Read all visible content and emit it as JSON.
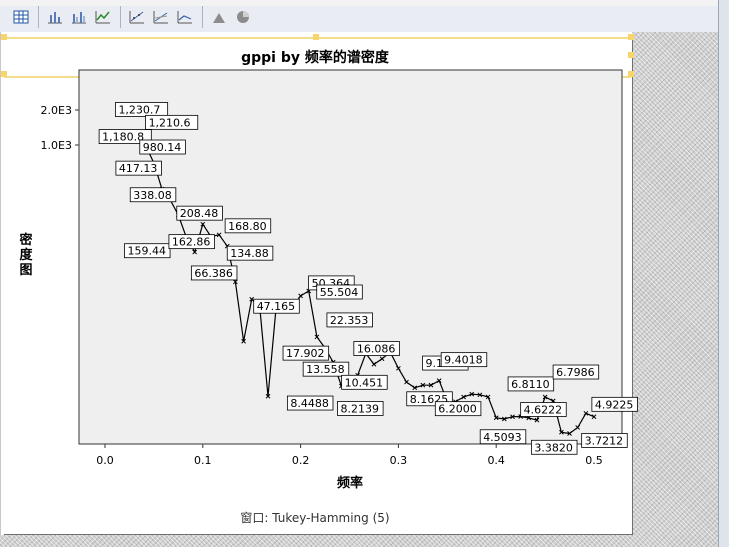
{
  "toolbar": {
    "icons": [
      "pivot-table-icon",
      "bar-chart-icon",
      "clustered-bar-icon",
      "line-chart-icon",
      "scatter-icon",
      "scatter-matrix-icon",
      "line-icon",
      "area-icon",
      "pie-icon"
    ]
  },
  "colors": {
    "plot_background": "#efefef",
    "line": "#000000",
    "selection_handle": "#f7d56b"
  },
  "footnote": "窗口: Tukey-Hamming (5)",
  "chart_data": {
    "type": "line",
    "title": "gppi by 频率的谱密度",
    "xlabel": "频率",
    "ylabel": "密度图",
    "y_scale": "log",
    "xlim": [
      -0.03,
      0.53
    ],
    "x_ticks": [
      0.0,
      0.1,
      0.2,
      0.3,
      0.4,
      0.5
    ],
    "x_tick_labels": [
      "0.0",
      "0.1",
      "0.2",
      "0.3",
      "0.4",
      "0.5"
    ],
    "y_ticks": [
      2000,
      1000
    ],
    "y_tick_labels": [
      "2.0E3",
      "1.0E3"
    ],
    "grid": false,
    "series": [
      {
        "x": [
          0.0083,
          0.0167,
          0.025,
          0.0333,
          0.0417,
          0.05,
          0.0583,
          0.0667,
          0.075,
          0.0833,
          0.0917,
          0.1,
          0.1083,
          0.1167,
          0.125,
          0.1333,
          0.1417,
          0.15,
          0.1583,
          0.1667,
          0.175,
          0.1833,
          0.1917,
          0.2,
          0.2083,
          0.2167,
          0.225,
          0.2333,
          0.2417,
          0.25,
          0.2583,
          0.2667,
          0.275,
          0.2833,
          0.2917,
          0.3,
          0.3083,
          0.3167,
          0.325,
          0.3333,
          0.3417,
          0.35,
          0.3583,
          0.3667,
          0.375,
          0.3833,
          0.3917,
          0.4,
          0.4083,
          0.4167,
          0.425,
          0.4333,
          0.4417,
          0.45,
          0.4583,
          0.4667,
          0.475,
          0.4833,
          0.4917,
          0.5
        ],
        "values": [
          1180.8,
          1190,
          1230.7,
          1210.6,
          980.14,
          700,
          417.13,
          338.08,
          250,
          159.44,
          120,
          208.48,
          162.86,
          168.8,
          134.88,
          66.386,
          20.5,
          47.165,
          40,
          6.9,
          40,
          42,
          40,
          50.364,
          55.504,
          22.353,
          17.902,
          13.558,
          8.4488,
          8.2139,
          10.451,
          16.086,
          13,
          14.5,
          16.5,
          12,
          9.1439,
          8.1625,
          8.6,
          8.6,
          9.4018,
          6.2,
          6.2,
          6.8,
          7.2,
          7.1,
          6.811,
          4.5093,
          4.4,
          4.6,
          4.6222,
          4.5,
          4.3,
          6.7986,
          6.3,
          3.382,
          3.3,
          3.7212,
          4.9225,
          4.6
        ]
      }
    ],
    "data_labels": [
      {
        "x": 0.0083,
        "value": "1,230.7",
        "label_y": 1230.7,
        "at": 0.025
      },
      {
        "x": 0.0083,
        "value": "1,180.8",
        "label_y": 1180.8,
        "at": 0.0083
      },
      {
        "x": 0.0333,
        "value": "1,210.6",
        "label_y": 1210.6,
        "at": 0.0333
      },
      {
        "x": 0.0417,
        "value": "980.14",
        "label_y": 980.14,
        "at": 0.0417
      },
      {
        "x": 0.05,
        "value": "417.13",
        "label_y": 417.13,
        "at": 0.05
      },
      {
        "x": 0.0667,
        "value": "338.08",
        "label_y": 338.08,
        "at": 0.0667
      },
      {
        "x": 0.1,
        "value": "208.48",
        "label_y": 208.48,
        "at": 0.1
      },
      {
        "x": 0.1167,
        "value": "168.80",
        "label_y": 168.8,
        "at": 0.1167
      },
      {
        "x": 0.0833,
        "value": "159.44",
        "label_y": 159.44,
        "at": 0.0833
      },
      {
        "x": 0.1083,
        "value": "162.86",
        "label_y": 162.86,
        "at": 0.1083
      },
      {
        "x": 0.125,
        "value": "134.88",
        "label_y": 134.88,
        "at": 0.125
      },
      {
        "x": 0.1333,
        "value": "66.386",
        "label_y": 66.386,
        "at": 0.1333
      },
      {
        "x": 0.1667,
        "value": "47.165",
        "label_y": 47.165,
        "at": 0.15
      },
      {
        "x": 0.2,
        "value": "50.364",
        "label_y": 50.364,
        "at": 0.2
      },
      {
        "x": 0.2083,
        "value": "55.504",
        "label_y": 55.504,
        "at": 0.2083
      },
      {
        "x": 0.2167,
        "value": "22.353",
        "label_y": 22.353,
        "at": 0.2167
      },
      {
        "x": 0.225,
        "value": "17.902",
        "label_y": 17.902,
        "at": 0.225
      },
      {
        "x": 0.2333,
        "value": "13.558",
        "label_y": 13.558,
        "at": 0.2333
      },
      {
        "x": 0.2417,
        "value": "8.4488",
        "label_y": 8.4488,
        "at": 0.2417
      },
      {
        "x": 0.25,
        "value": "8.2139",
        "label_y": 8.2139,
        "at": 0.25
      },
      {
        "x": 0.2583,
        "value": "10.451",
        "label_y": 10.451,
        "at": 0.2583
      },
      {
        "x": 0.2667,
        "value": "16.086",
        "label_y": 16.086,
        "at": 0.2667
      },
      {
        "x": 0.3083,
        "value": "9.1439",
        "label_y": 9.1439,
        "at": 0.3083
      },
      {
        "x": 0.3167,
        "value": "8.1625",
        "label_y": 8.1625,
        "at": 0.3167
      },
      {
        "x": 0.3417,
        "value": "9.4018",
        "label_y": 9.4018,
        "at": 0.3417
      },
      {
        "x": 0.35,
        "value": "6.2000",
        "label_y": 6.2,
        "at": 0.35
      },
      {
        "x": 0.3917,
        "value": "6.8110",
        "label_y": 6.811,
        "at": 0.3917
      },
      {
        "x": 0.4,
        "value": "4.5093",
        "label_y": 4.5093,
        "at": 0.4
      },
      {
        "x": 0.425,
        "value": "4.6222",
        "label_y": 4.6222,
        "at": 0.425
      },
      {
        "x": 0.45,
        "value": "6.7986",
        "label_y": 6.7986,
        "at": 0.45
      },
      {
        "x": 0.4667,
        "value": "3.3820",
        "label_y": 3.382,
        "at": 0.4667
      },
      {
        "x": 0.4833,
        "value": "3.7212",
        "label_y": 3.7212,
        "at": 0.4833
      },
      {
        "x": 0.4917,
        "value": "4.9225",
        "label_y": 4.9225,
        "at": 0.4917
      }
    ]
  }
}
